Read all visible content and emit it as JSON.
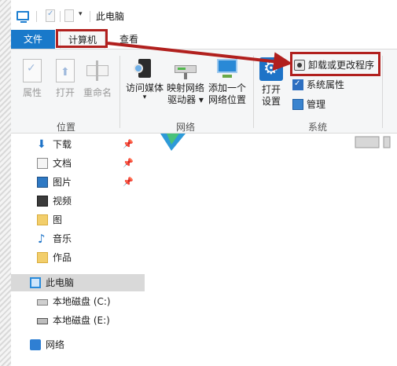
{
  "window": {
    "title": "此电脑"
  },
  "menu": {
    "file": "文件",
    "computer": "计算机",
    "view": "查看"
  },
  "ribbon": {
    "location": {
      "label": "位置",
      "properties": "属性",
      "open": "打开",
      "rename": "重命名"
    },
    "network": {
      "label": "网络",
      "access_media_line1": "访问媒体",
      "access_media_arrow": "▾",
      "map_drive_line1": "映射网络",
      "map_drive_line2": "驱动器 ▾",
      "add_location_line1": "添加一个",
      "add_location_line2": "网络位置"
    },
    "system": {
      "label": "系统",
      "open_settings_line1": "打开",
      "open_settings_line2": "设置",
      "uninstall": "卸载或更改程序",
      "system_properties": "系统属性",
      "manage": "管理"
    }
  },
  "nav": {
    "items": [
      {
        "label": "下载",
        "pinned": true
      },
      {
        "label": "文档",
        "pinned": true
      },
      {
        "label": "图片",
        "pinned": true
      },
      {
        "label": "视频",
        "pinned": false
      },
      {
        "label": "图",
        "pinned": false
      },
      {
        "label": "音乐",
        "pinned": false
      },
      {
        "label": "作品",
        "pinned": false
      },
      {
        "label": "此电脑",
        "pinned": false,
        "selected": true
      },
      {
        "label": "本地磁盘 (C:)",
        "pinned": false
      },
      {
        "label": "本地磁盘 (E:)",
        "pinned": false
      },
      {
        "label": "网络",
        "pinned": false
      }
    ],
    "pin_glyph": "📌"
  },
  "colors": {
    "accent": "#1979ca",
    "annotation": "#b1201e",
    "selected": "#d9d9d9"
  }
}
